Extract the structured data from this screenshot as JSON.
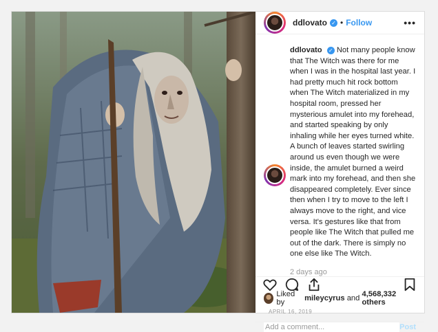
{
  "post": {
    "username": "ddlovato",
    "follow_label": "Follow",
    "more_label": "•••",
    "caption_text": "Not many people know that The Witch was there for me when I was in the hospital last year. I had pretty much hit rock bottom when The Witch materialized in my hospital room, pressed her mysterious amulet into my forehead, and started speaking by only inhaling while her eyes turned white. A bunch of leaves started swirling around us even though we were inside, the amulet burned a weird mark into my forehead, and then she disappeared completely. Ever since then when I try to move to the left I always move to the right, and vice versa. It's gestures like that from people like The Witch that pulled me out of the dark. There is simply no one else like The Witch.",
    "timestamp": "2 days ago",
    "likes": {
      "prefix": "Liked by",
      "user": "mileycyrus",
      "and": "and",
      "count": "4,568,332 others"
    },
    "date": "APRIL 16, 2019",
    "comment_placeholder": "Add a comment...",
    "post_label": "Post"
  },
  "icons": {
    "verified": "verified-badge-icon",
    "like": "heart-icon",
    "comment": "comment-icon",
    "share": "share-icon",
    "save": "bookmark-icon"
  },
  "colors": {
    "accent": "#3897f0",
    "post_disabled": "#b2dffc",
    "muted": "#999999"
  }
}
